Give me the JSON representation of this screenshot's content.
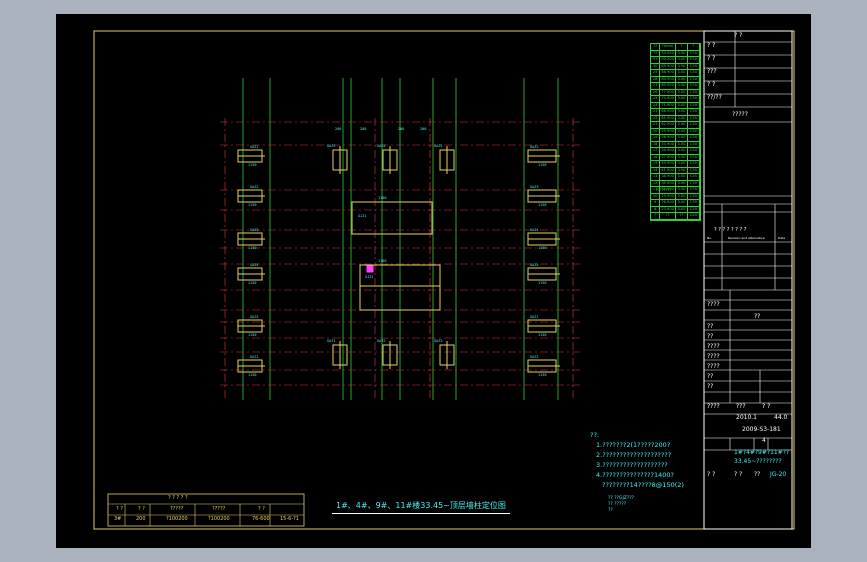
{
  "drawing": {
    "title": "1#、4#、9#、11#楼33.45~顶层墙柱定位图",
    "notes_title": "??:",
    "notes": [
      "1.???????2(1?????200?",
      "2.????????????????????",
      "3.???????????????????",
      "4.???????????????1400?",
      "????????14????8@150(2)"
    ],
    "legend_lines": [
      "?? ??GJZ???",
      "?? ?????",
      "??"
    ]
  },
  "title_block": {
    "header": "? ?",
    "rows_top": [
      {
        "label": "? ?"
      },
      {
        "label": "? ?"
      },
      {
        "label": "???"
      },
      {
        "label": "? ?"
      },
      {
        "label": "??/??"
      }
    ],
    "company": "?????",
    "approval_header": "? ? ? ? ? ? ? ?",
    "approval_cols": [
      "No.",
      "Revision and Alternative",
      "Date"
    ],
    "project_label": "????",
    "project_value": "??",
    "role_rows": [
      "??",
      "??",
      "????",
      "????",
      "????",
      "??",
      "??"
    ],
    "stage_labels": [
      "????",
      "???",
      "? ?"
    ],
    "stage_values": [
      "2010.1",
      "44.0"
    ],
    "drawing_no": "2009-S3-181",
    "sheet_no": "4",
    "drawing_name_1": "1#?4#?9#?11#??",
    "drawing_name_2": "33.45~????????",
    "bottom_labels": [
      "? ?",
      "? ?",
      "??"
    ],
    "bottom_value": "JG-20"
  },
  "rebar_table": {
    "header": [
      "??",
      "?(mm)",
      "?",
      "?"
    ],
    "rows": [
      [
        "??",
        "33.450",
        "3.00",
        "C30"
      ],
      [
        "31",
        "93.200",
        "3.00",
        "C30"
      ],
      [
        "30",
        "89.900",
        "3.00",
        "C30"
      ],
      [
        "29",
        "86.900",
        "3.00",
        "C30"
      ],
      [
        "28",
        "83.900",
        "3.00",
        "C30"
      ],
      [
        "27",
        "80.900",
        "3.00",
        "C30"
      ],
      [
        "26",
        "77.900",
        "3.00",
        "C30"
      ],
      [
        "25",
        "74.900",
        "3.00",
        "C30"
      ],
      [
        "24",
        "71.900",
        "3.00",
        "C30"
      ],
      [
        "23",
        "68.900",
        "3.00",
        "C30"
      ],
      [
        "22",
        "65.900",
        "3.00",
        "C30"
      ],
      [
        "21",
        "62.900",
        "3.00",
        "C30"
      ],
      [
        "20",
        "59.900",
        "3.00",
        "C30"
      ],
      [
        "19",
        "56.900",
        "3.00",
        "C30"
      ],
      [
        "18",
        "53.900",
        "3.00",
        "C30"
      ],
      [
        "17",
        "50.900",
        "3.00",
        "C30"
      ],
      [
        "16",
        "47.900",
        "3.00",
        "C30"
      ],
      [
        "15",
        "44.900",
        "3.00",
        "C35"
      ],
      [
        "14",
        "41.900",
        "3.00",
        "C35"
      ],
      [
        "13",
        "38.900",
        "3.00",
        "C35"
      ],
      [
        "12",
        "35.900",
        "3.00",
        "C35"
      ],
      [
        "11",
        "32.900",
        "3.00",
        "C35"
      ],
      [
        "10",
        "29.900",
        "3.00",
        "C35"
      ],
      [
        "9",
        "26.900",
        "3.00",
        "C35"
      ],
      [
        "8",
        "23.900",
        "3.00",
        "C35"
      ],
      [
        "?",
        "??",
        "??",
        "C40"
      ]
    ],
    "footer": "????????"
  },
  "bottom_table": {
    "header": "? ? ? ? ?",
    "cols": [
      "? ?",
      "? ?",
      "?????",
      "?????",
      "? ?"
    ],
    "values": [
      "3#",
      "200",
      "?100200",
      "?100200",
      "76-600",
      "15-6-?1"
    ]
  },
  "wall_labels": [
    "GAZ1",
    "GAZ2",
    "GAZ3",
    "GAZ4",
    "GAZ5",
    "GAZ6",
    "GJZ1"
  ],
  "dims": [
    "1150",
    "200",
    "600",
    "200",
    "1700",
    "200"
  ],
  "colors": {
    "background": "#000000",
    "frame": "#e8d060",
    "axis": "#2fcf3b",
    "gridline": "#e23b3b",
    "wall": "#e8d060",
    "text_cyan": "#47f0f0",
    "title_block_line": "#ffffff",
    "magenta": "#ff40ff"
  }
}
